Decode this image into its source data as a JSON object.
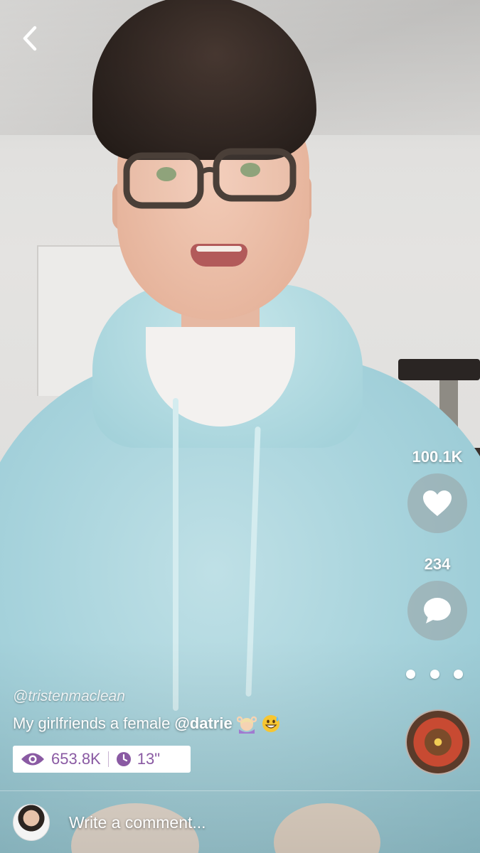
{
  "nav": {
    "back_icon": "chevron-left-icon"
  },
  "video": {
    "author_handle": "@tristenmaclean",
    "caption_text": "My girlfriends a female",
    "caption_mention": "@datrie",
    "caption_emojis": [
      "woman-gesturing-ok",
      "grinning-face-with-sweat"
    ]
  },
  "actions": {
    "likes_count": "100.1K",
    "like_icon": "heart-icon",
    "comments_count": "234",
    "comment_icon": "speech-bubble-icon",
    "more_icon": "more-dots-icon"
  },
  "stats": {
    "views_icon": "eye-icon",
    "views": "653.8K",
    "duration_icon": "clock-icon",
    "duration": "13\""
  },
  "comment_bar": {
    "placeholder": "Write a comment..."
  },
  "colors": {
    "accent_purple": "#8a5aa3",
    "overlay_text": "#ffffff"
  }
}
